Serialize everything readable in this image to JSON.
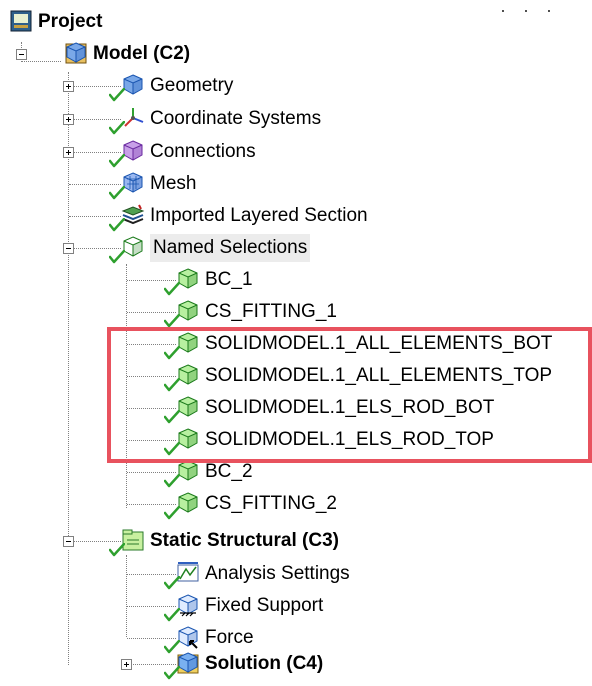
{
  "tree": {
    "project": {
      "label": "Project"
    },
    "model": {
      "label": "Model (C2)"
    },
    "model_children": [
      {
        "label": "Geometry",
        "icon": "geometry-icon",
        "expander": "plus"
      },
      {
        "label": "Coordinate Systems",
        "icon": "coordinate-systems-icon",
        "expander": "plus"
      },
      {
        "label": "Connections",
        "icon": "connections-icon",
        "expander": "plus"
      },
      {
        "label": "Mesh",
        "icon": "mesh-icon",
        "expander": "none"
      },
      {
        "label": "Imported Layered Section",
        "icon": "layered-section-icon",
        "expander": "none"
      },
      {
        "label": "Named Selections",
        "icon": "named-selections-icon",
        "expander": "minus"
      }
    ],
    "named_selections": [
      {
        "label": "BC_1"
      },
      {
        "label": "CS_FITTING_1"
      },
      {
        "label": "SOLIDMODEL.1_ALL_ELEMENTS_BOT"
      },
      {
        "label": "SOLIDMODEL.1_ALL_ELEMENTS_TOP"
      },
      {
        "label": "SOLIDMODEL.1_ELS_ROD_BOT"
      },
      {
        "label": "SOLIDMODEL.1_ELS_ROD_TOP"
      },
      {
        "label": "BC_2"
      },
      {
        "label": "CS_FITTING_2"
      }
    ],
    "static_structural": {
      "label": "Static Structural (C3)"
    },
    "static_children": [
      {
        "label": "Analysis Settings",
        "icon": "analysis-settings-icon"
      },
      {
        "label": "Fixed Support",
        "icon": "fixed-support-icon"
      },
      {
        "label": "Force",
        "icon": "force-icon"
      }
    ],
    "solution": {
      "label": "Solution (C4)"
    }
  },
  "colors": {
    "highlight": "#e8525e",
    "check": "#2ea02e",
    "selection_bg": "#ececec"
  }
}
